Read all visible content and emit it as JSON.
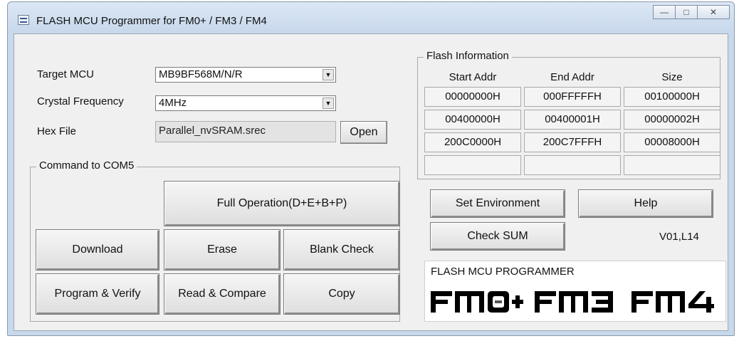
{
  "window": {
    "title": "FLASH MCU Programmer for FM0+ / FM3 / FM4",
    "icon": "app-icon"
  },
  "caption_buttons": {
    "minimize": "—",
    "maximize": "□",
    "close": "✕"
  },
  "target_mcu": {
    "label": "Target MCU",
    "value": "MB9BF568M/N/R"
  },
  "crystal_frequency": {
    "label": "Crystal Frequency",
    "value": "4MHz"
  },
  "hex_file": {
    "label": "Hex File",
    "value": "Parallel_nvSRAM.srec",
    "open_label": "Open"
  },
  "command_group": {
    "title": "Command  to  COM5",
    "full_operation": "Full Operation(D+E+B+P)",
    "download": "Download",
    "erase": "Erase",
    "blank_check": "Blank Check",
    "program_verify": "Program & Verify",
    "read_compare": "Read & Compare",
    "copy": "Copy"
  },
  "flash_info": {
    "title": "Flash Information",
    "headers": [
      "Start Addr",
      "End Addr",
      "Size"
    ],
    "rows": [
      [
        "00000000H",
        "000FFFFFH",
        "00100000H"
      ],
      [
        "00400000H",
        "00400001H",
        "00000002H"
      ],
      [
        "200C0000H",
        "200C7FFFH",
        "00008000H"
      ],
      [
        "",
        "",
        ""
      ]
    ]
  },
  "set_environment": "Set Environment",
  "help": "Help",
  "check_sum": "Check SUM",
  "version": "V01,L14",
  "logo": {
    "caption": "FLASH MCU PROGRAMMER",
    "wordmark": "FM0+  FM3  FM4"
  }
}
